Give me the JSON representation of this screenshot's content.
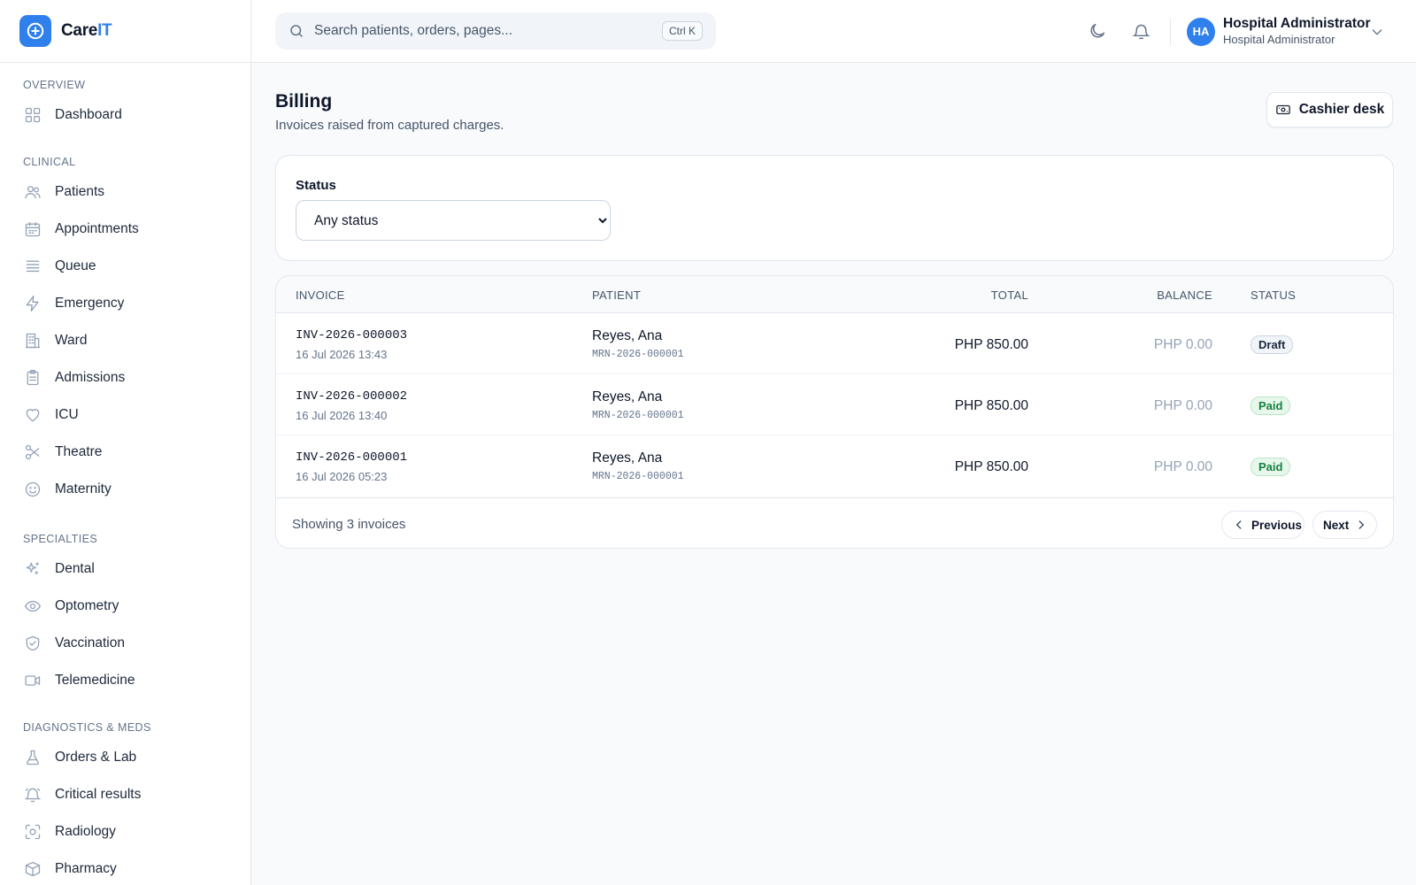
{
  "brand": {
    "name_part1": "Care",
    "name_part2": "IT"
  },
  "search": {
    "placeholder": "Search patients, orders, pages...",
    "shortcut": "Ctrl K"
  },
  "user": {
    "initials": "HA",
    "name": "Hospital Administrator",
    "role": "Hospital Administrator"
  },
  "sidebar": {
    "sections": [
      {
        "title": "Overview",
        "items": [
          {
            "label": "Dashboard",
            "icon": "grid-icon"
          }
        ]
      },
      {
        "title": "Clinical",
        "items": [
          {
            "label": "Patients",
            "icon": "users-icon"
          },
          {
            "label": "Appointments",
            "icon": "calendar-icon"
          },
          {
            "label": "Queue",
            "icon": "list-icon"
          },
          {
            "label": "Emergency",
            "icon": "zap-icon"
          },
          {
            "label": "Ward",
            "icon": "building-icon"
          },
          {
            "label": "Admissions",
            "icon": "clipboard-icon"
          },
          {
            "label": "ICU",
            "icon": "heart-icon"
          },
          {
            "label": "Theatre",
            "icon": "scissors-icon"
          },
          {
            "label": "Maternity",
            "icon": "smile-icon"
          }
        ]
      },
      {
        "title": "Specialties",
        "items": [
          {
            "label": "Dental",
            "icon": "sparkles-icon"
          },
          {
            "label": "Optometry",
            "icon": "eye-icon"
          },
          {
            "label": "Vaccination",
            "icon": "shield-check-icon"
          },
          {
            "label": "Telemedicine",
            "icon": "video-icon"
          }
        ]
      },
      {
        "title": "Diagnostics & Meds",
        "items": [
          {
            "label": "Orders & Lab",
            "icon": "flask-icon"
          },
          {
            "label": "Critical results",
            "icon": "bell-ring-icon"
          },
          {
            "label": "Radiology",
            "icon": "scan-icon"
          },
          {
            "label": "Pharmacy",
            "icon": "package-icon"
          }
        ]
      }
    ]
  },
  "page": {
    "title": "Billing",
    "subtitle": "Invoices raised from captured charges.",
    "cashier_button": "Cashier desk"
  },
  "filter": {
    "label": "Status",
    "selected": "Any status"
  },
  "table": {
    "headers": {
      "invoice": "Invoice",
      "patient": "Patient",
      "total": "Total",
      "balance": "Balance",
      "status": "Status"
    },
    "rows": [
      {
        "invoice": "INV-2026-000003",
        "date": "16 Jul 2026 13:43",
        "patient": "Reyes, Ana",
        "mrn": "MRN-2026-000001",
        "total": "PHP 850.00",
        "balance": "PHP 0.00",
        "status": "Draft"
      },
      {
        "invoice": "INV-2026-000002",
        "date": "16 Jul 2026 13:40",
        "patient": "Reyes, Ana",
        "mrn": "MRN-2026-000001",
        "total": "PHP 850.00",
        "balance": "PHP 0.00",
        "status": "Paid"
      },
      {
        "invoice": "INV-2026-000001",
        "date": "16 Jul 2026 05:23",
        "patient": "Reyes, Ana",
        "mrn": "MRN-2026-000001",
        "total": "PHP 850.00",
        "balance": "PHP 0.00",
        "status": "Paid"
      }
    ],
    "footer": {
      "showing": "Showing 3 invoices",
      "prev": "Previous",
      "next": "Next"
    }
  },
  "colors": {
    "accent": "#2f80ed",
    "paid": "#15803d",
    "draft": "#1e293b"
  }
}
